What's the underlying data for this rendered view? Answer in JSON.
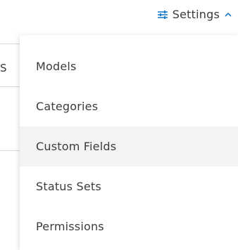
{
  "header": {
    "settings_label": "Settings",
    "settings_icon": "sliders-icon",
    "chevron_icon": "chevron-up-icon",
    "accent_color": "#1f7ec9"
  },
  "background": {
    "partial_letter": "S"
  },
  "menu": {
    "items": [
      {
        "label": "Models"
      },
      {
        "label": "Categories"
      },
      {
        "label": "Custom Fields",
        "hovered": true
      },
      {
        "label": "Status Sets"
      },
      {
        "label": "Permissions"
      }
    ]
  }
}
